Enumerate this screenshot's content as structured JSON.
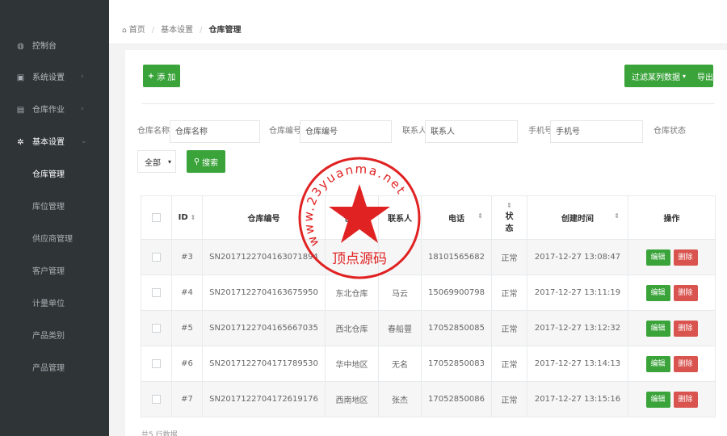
{
  "sidebar": {
    "items": [
      {
        "label": "控制台",
        "icon": "dashboard-icon",
        "glyph": "◍"
      },
      {
        "label": "系统设置",
        "icon": "monitor-icon",
        "glyph": "▣",
        "chevron": "›"
      },
      {
        "label": "仓库作业",
        "icon": "document-icon",
        "glyph": "▤",
        "chevron": "›"
      },
      {
        "label": "基本设置",
        "icon": "cogs-icon",
        "glyph": "✲",
        "chevron": "⌄"
      }
    ],
    "subitems": [
      "仓库管理",
      "库位管理",
      "供应商管理",
      "客户管理",
      "计量单位",
      "产品类别",
      "产品管理"
    ]
  },
  "breadcrumb": {
    "home_glyph": "⌂",
    "home": "首页",
    "sep": "/",
    "level1": "基本设置",
    "current": "仓库管理"
  },
  "toolbar": {
    "add_label": "添 加",
    "add_glyph": "+",
    "filter_label": "过滤某列数据",
    "filter_caret": "▾",
    "export_label": "导出"
  },
  "search": {
    "name_label": "仓库名称",
    "name_placeholder": "仓库名称",
    "code_label": "仓库编号",
    "code_placeholder": "仓库编号",
    "contact_label": "联系人",
    "contact_placeholder": "联系人",
    "phone_label": "手机号",
    "phone_placeholder": "手机号",
    "status_label": "仓库状态",
    "status_selected": "全部",
    "status_caret": "▾",
    "search_label": "搜索",
    "search_glyph": "⚲"
  },
  "table": {
    "sort_glyph": "⇕",
    "columns": [
      "ID",
      "仓库编号",
      "仓库",
      "联系人",
      "电话",
      "状态",
      "创建时间",
      "操作"
    ],
    "status_col_lines": [
      "状",
      "态"
    ],
    "rows": [
      {
        "id": "#3",
        "code": "SN20171227041630​71894",
        "name": "",
        "contact": "",
        "phone": "18101565682",
        "status": "正常",
        "created": "2017-12-27 13:08:47"
      },
      {
        "id": "#4",
        "code": "SN20171227041636​75950",
        "name": "东北仓库",
        "contact": "马云",
        "phone": "15069900798",
        "status": "正常",
        "created": "2017-12-27 13:11:19"
      },
      {
        "id": "#5",
        "code": "SN20171227041656​67035",
        "name": "西北仓库",
        "contact": "春船豐",
        "phone": "17052850085",
        "status": "正常",
        "created": "2017-12-27 13:12:32"
      },
      {
        "id": "#6",
        "code": "SN20171227041717​89530",
        "name": "华中地区",
        "contact": "无名",
        "phone": "17052850083",
        "status": "正常",
        "created": "2017-12-27 13:14:13"
      },
      {
        "id": "#7",
        "code": "SN20171227041726​19176",
        "name": "西南地区",
        "contact": "张杰",
        "phone": "17052850086",
        "status": "正常",
        "created": "2017-12-27 13:15:16"
      }
    ],
    "edit_label": "编辑",
    "delete_label": "删除"
  },
  "footer": {
    "summary": "共5 行数据"
  },
  "watermark": {
    "url": "www.23yuanma.net",
    "name": "顶点源码",
    "color": "#e02222"
  }
}
